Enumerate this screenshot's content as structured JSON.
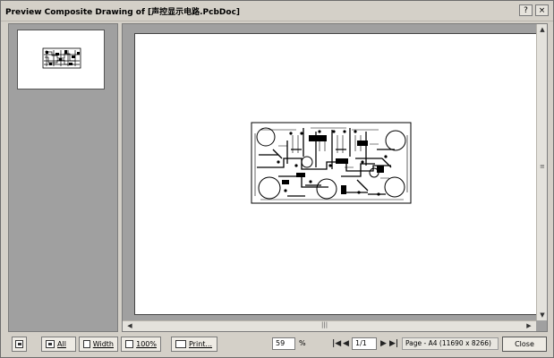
{
  "window": {
    "title": "Preview Composite Drawing of [声控显示电路.PcbDoc]",
    "help_label": "?",
    "close_label": "×"
  },
  "toolbar": {
    "all_label": "All",
    "width_label": "Width",
    "hundred_label": "100%",
    "print_label": "Print...",
    "zoom_value": "59",
    "zoom_unit": "%",
    "page_value": "1/1",
    "page_info": "Page - A4 (11690 x 8266)",
    "close_label": "Close"
  },
  "icons": {
    "first": "first-page-icon",
    "prev": "previous-page-icon",
    "next": "next-page-icon",
    "last": "last-page-icon"
  }
}
